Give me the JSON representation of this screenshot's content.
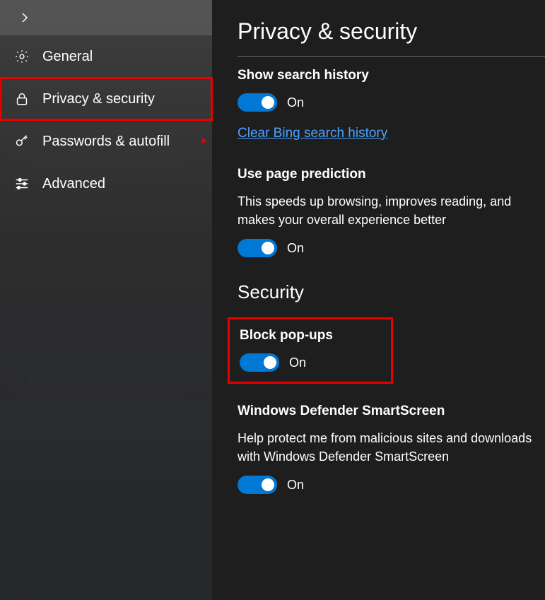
{
  "sidebar": {
    "items": [
      {
        "label": "General"
      },
      {
        "label": "Privacy & security"
      },
      {
        "label": "Passwords & autofill"
      },
      {
        "label": "Advanced"
      }
    ]
  },
  "main": {
    "title": "Privacy & security",
    "show_search": {
      "title": "Show search history",
      "state": "On"
    },
    "clear_link": "Clear Bing search history",
    "page_prediction": {
      "title": "Use page prediction",
      "desc": "This speeds up browsing, improves reading, and makes your overall experience better",
      "state": "On"
    },
    "security_heading": "Security",
    "block_popups": {
      "title": "Block pop-ups",
      "state": "On"
    },
    "smartscreen": {
      "title": "Windows Defender SmartScreen",
      "desc": "Help protect me from malicious sites and downloads with Windows Defender SmartScreen",
      "state": "On"
    }
  }
}
